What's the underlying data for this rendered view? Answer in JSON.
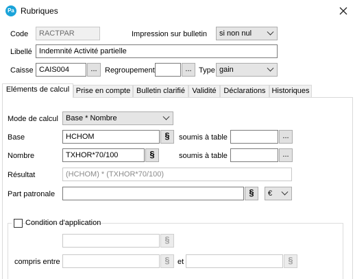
{
  "window": {
    "app_badge": "Pa",
    "title": "Rubriques"
  },
  "header": {
    "code_label": "Code",
    "code_value": "RACTPAR",
    "impression_label": "Impression sur bulletin",
    "impression_value": "si non nul",
    "libelle_label": "Libellé",
    "libelle_value": "Indemnité Activité partielle",
    "caisse_label": "Caisse",
    "caisse_value": "CAIS004",
    "caisse_lookup": "...",
    "regroupement_label": "Regroupement",
    "regroupement_value": "",
    "regroupement_lookup": "...",
    "type_label": "Type",
    "type_value": "gain"
  },
  "tabs": [
    {
      "label": "Eléments de calcul",
      "active": true
    },
    {
      "label": "Prise en compte",
      "active": false
    },
    {
      "label": "Bulletin clarifié",
      "active": false
    },
    {
      "label": "Validité",
      "active": false
    },
    {
      "label": "Déclarations",
      "active": false
    },
    {
      "label": "Historiques",
      "active": false
    }
  ],
  "calc": {
    "mode_label": "Mode de calcul",
    "mode_value": "Base * Nombre",
    "base_label": "Base",
    "base_value": "HCHOM",
    "base_formula_glyph": "§",
    "base_table_label": "soumis à table",
    "base_table_value": "",
    "base_table_lookup": "...",
    "nombre_label": "Nombre",
    "nombre_value": "TXHOR*70/100",
    "nombre_formula_glyph": "§",
    "nombre_table_label": "soumis à table",
    "nombre_table_value": "",
    "nombre_table_lookup": "...",
    "resultat_label": "Résultat",
    "resultat_value": "(HCHOM) * (TXHOR*70/100)",
    "part_label": "Part patronale",
    "part_value": "",
    "part_formula_glyph": "§",
    "part_currency": "€"
  },
  "condition": {
    "checkbox_label": "Condition d'application",
    "checked": false,
    "field_value": "",
    "formula_glyph": "§",
    "compris_label": "compris entre",
    "compris_from": "",
    "et_label": "et",
    "compris_to": ""
  }
}
